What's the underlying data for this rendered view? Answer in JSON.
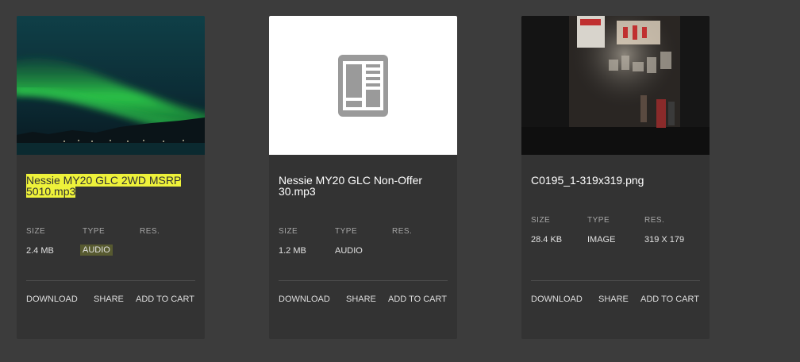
{
  "meta_labels": {
    "size": "SIZE",
    "type": "TYPE",
    "res": "RES."
  },
  "actions": {
    "download": "DOWNLOAD",
    "share": "SHARE",
    "add_to_cart": "ADD TO CART"
  },
  "cards": [
    {
      "title_highlighted": "Nessie MY20 GLC 2WD MSRP",
      "title_line2": "5010.mp3",
      "size": "2.4 MB",
      "type": "AUDIO",
      "res": ""
    },
    {
      "title_line1": "Nessie MY20 GLC Non-Offer",
      "title_line2": "30.mp3",
      "size": "1.2 MB",
      "type": "AUDIO",
      "res": "",
      "thumb_icon": "document-icon"
    },
    {
      "title_line1": "C0195_1-319x319.png",
      "size": "28.4 KB",
      "type": "IMAGE",
      "res": "319 X 179"
    }
  ],
  "colors": {
    "highlight": "#eef23a",
    "card_bg": "#333333",
    "page_bg": "#3c3c3c",
    "aurora": "#2fd84a"
  }
}
